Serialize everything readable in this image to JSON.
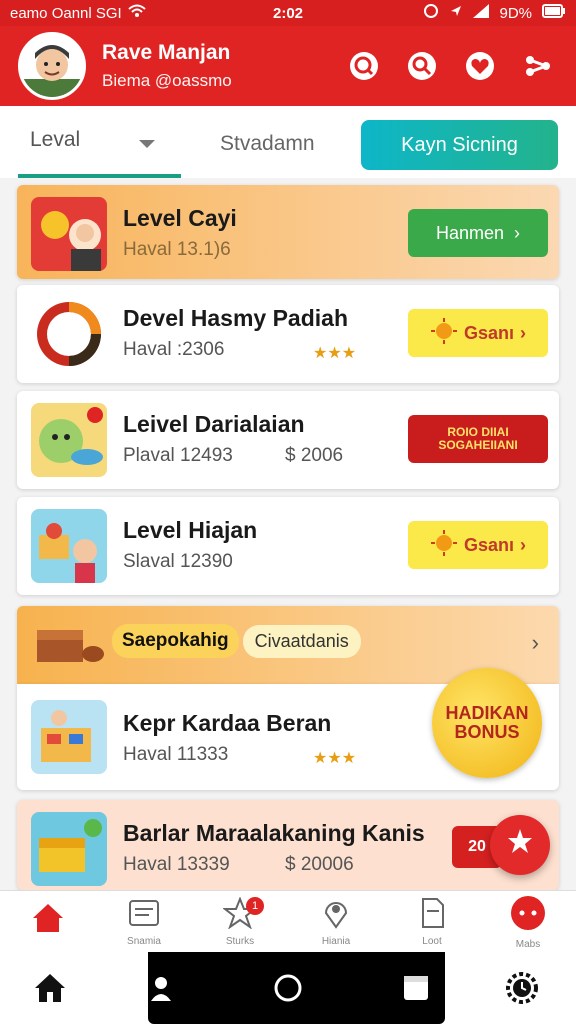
{
  "status_bar": {
    "left": "eamo Oannl SGI",
    "time": "2:02",
    "battery": "9D%"
  },
  "header": {
    "name": "Rave Manjan",
    "handle": "Biema @oassmo"
  },
  "tabs": {
    "tab1": "Leval",
    "tab2": "Stvadamn",
    "cta": "Kayn Sicning"
  },
  "cards": [
    {
      "title": "Level Cayi",
      "subtitle": "Haval 13.1)6",
      "button": "Hanmen"
    },
    {
      "title": "Devel Hasmy Padiah",
      "subtitle": "Haval :2306",
      "stars": "★★★",
      "button": "Gsanı"
    },
    {
      "title": "Leivel Darialaian",
      "subtitle": "Plaval 12493",
      "price": "$ 2006",
      "button_line1": "ROIO DIIAI",
      "button_line2": "SOGAHEIIANI"
    },
    {
      "title": "Level Hiajan",
      "subtitle": "Slaval 12390",
      "button": "Gsanı"
    },
    {
      "pill1": "Saepokahig",
      "pill2": "Civaatdanis"
    },
    {
      "title": "Kepr Kardaa Beran",
      "subtitle": "Haval 11333",
      "stars": "★★★"
    },
    {
      "title": "Barlar Maraalakaning Kanis",
      "subtitle": "Haval 13339",
      "price": "$ 20006",
      "tag": "20"
    }
  ],
  "bonus": {
    "line1": "HADIKAN",
    "line2": "BONUS"
  },
  "tabbar": {
    "labels": [
      "",
      "Snamia",
      "Sturks",
      "Hiania",
      "Loot",
      "Mabs"
    ],
    "notification_count": "1"
  },
  "colors": {
    "primary": "#e02424",
    "accent": "#1a9e86",
    "cta_start": "#0db6c8",
    "cta_end": "#23b38c"
  },
  "icons": [
    "search-icon",
    "magnify-icon",
    "heart-icon",
    "share-icon",
    "home-icon",
    "list-icon",
    "star-icon",
    "pin-icon",
    "document-icon",
    "more-icon"
  ]
}
